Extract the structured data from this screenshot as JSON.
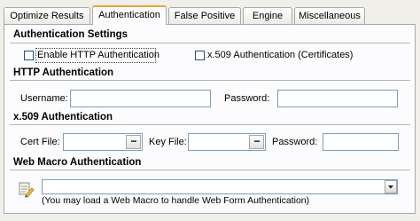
{
  "tabs": [
    {
      "label": "Optimize Results",
      "active": false
    },
    {
      "label": "Authentication",
      "active": true
    },
    {
      "label": "False Positive",
      "active": false
    },
    {
      "label": "Engine",
      "active": false
    },
    {
      "label": "Miscellaneous",
      "active": false
    }
  ],
  "auth_settings": {
    "title": "Authentication Settings",
    "enable_http_label": "Enable HTTP Authentication",
    "enable_http_checked": false,
    "x509_label": "x.509 Authentication (Certificates)",
    "x509_checked": false
  },
  "http_auth": {
    "title": "HTTP Authentication",
    "username_label": "Username:",
    "username_value": "",
    "password_label": "Password:",
    "password_value": ""
  },
  "x509_auth": {
    "title": "x.509 Authentication",
    "cert_file_label": "Cert File:",
    "cert_file_value": "",
    "key_file_label": "Key File:",
    "key_file_value": "",
    "password_label": "Password:",
    "password_value": "",
    "browse_label": "..."
  },
  "web_macro": {
    "title": "Web Macro Authentication",
    "selected_value": "",
    "hint": "(You may load a Web Macro to handle Web Form Authentication)",
    "icon": "macro-script-icon"
  },
  "colors": {
    "active_tab_accent": "#e6a33a",
    "field_border": "#7f9db9",
    "checkbox_border": "#1c5180",
    "panel_bg": "#fcfcfe",
    "window_bg": "#f0efe9"
  }
}
